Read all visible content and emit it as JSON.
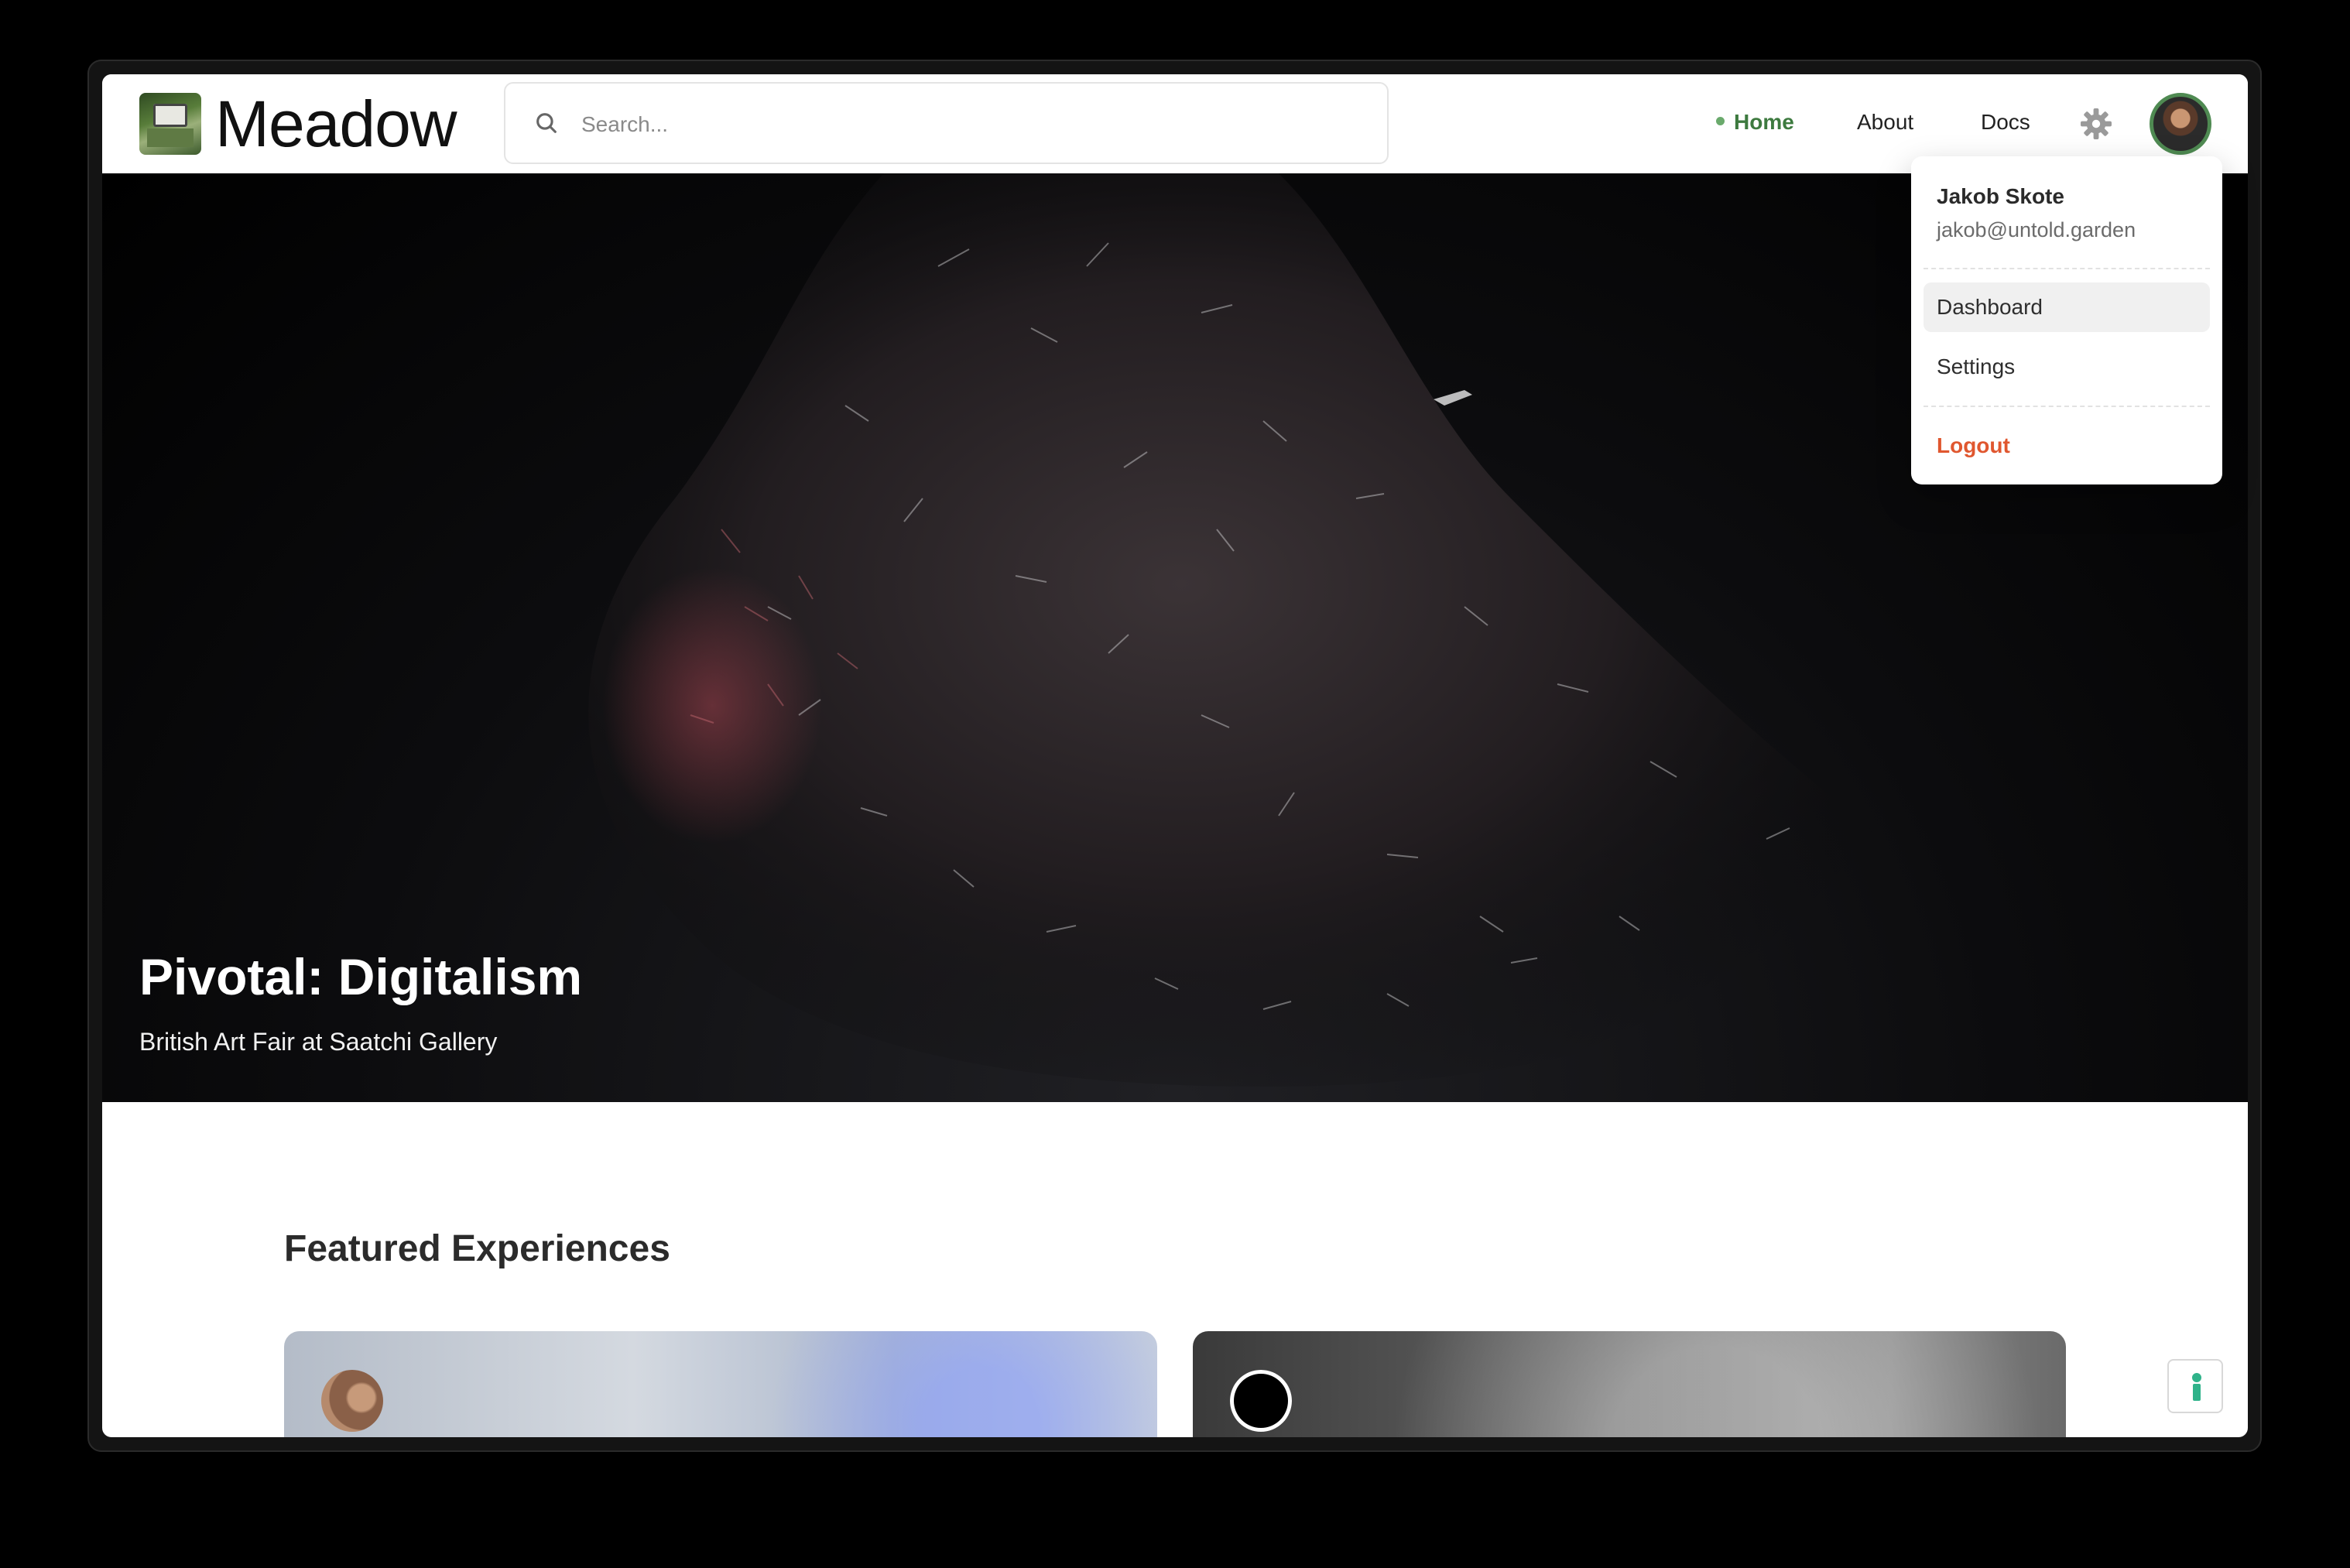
{
  "header": {
    "logo_text": "Meadow",
    "search_placeholder": "Search...",
    "nav": {
      "home": "Home",
      "about": "About",
      "docs": "Docs"
    },
    "accent_color": "#3d7a3f"
  },
  "hero": {
    "title": "Pivotal: Digitalism",
    "subtitle": "British Art Fair at Saatchi Gallery"
  },
  "featured": {
    "title": "Featured Experiences"
  },
  "user_menu": {
    "name": "Jakob Skote",
    "email": "jakob@untold.garden",
    "items": [
      "Dashboard",
      "Settings"
    ],
    "logout": "Logout",
    "logout_color": "#e0572f"
  }
}
